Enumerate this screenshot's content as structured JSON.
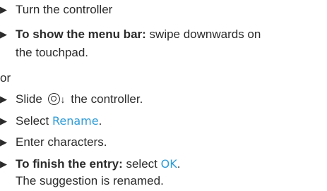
{
  "steps": {
    "turn_controller": {
      "bullet": "▶",
      "text": "Turn the controller"
    },
    "show_menu_bar": {
      "bullet": "▶",
      "bold": "To show the menu bar:",
      "text_line1": " swipe downwards on",
      "text_line2": "the touchpad."
    },
    "or_label": "or",
    "slide_controller": {
      "bullet": "▶",
      "text_before": "Slide ",
      "arrow": "↓",
      "text_after": " the controller."
    },
    "select_rename": {
      "bullet": "▶",
      "text": "Select ",
      "ui_label": "Rename",
      "suffix": "."
    },
    "enter_characters": {
      "bullet": "▶",
      "text": "Enter characters."
    },
    "finish_entry": {
      "bullet": "▶",
      "bold": "To finish the entry:",
      "text": " select ",
      "ui_label": "OK",
      "suffix": ".",
      "result": "The suggestion is renamed."
    }
  },
  "icons": {
    "controller": "controller-icon",
    "down": "down-arrow-icon"
  },
  "colors": {
    "text": "#2b2b2b",
    "ui_label": "#2f9bd6"
  }
}
